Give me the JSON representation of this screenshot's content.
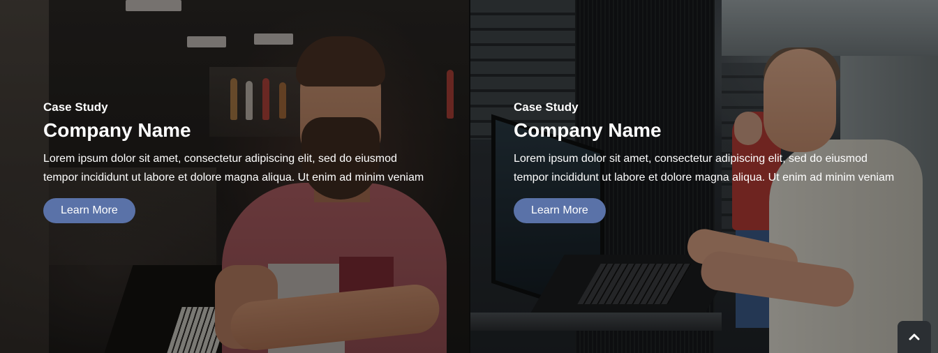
{
  "cards": [
    {
      "eyebrow": "Case Study",
      "title": "Company Name",
      "description": "Lorem ipsum dolor sit amet, consectetur adipiscing elit, sed do eiusmod tempor incididunt ut labore et dolore magna aliqua. Ut enim ad minim veniam",
      "button_label": "Learn More"
    },
    {
      "eyebrow": "Case Study",
      "title": "Company Name",
      "description": "Lorem ipsum dolor sit amet, consectetur adipiscing elit, sed do eiusmod tempor incididunt ut labore et dolore magna aliqua. Ut enim ad minim veniam",
      "button_label": "Learn More"
    }
  ],
  "scroll_top": {
    "icon": "chevron-up-icon"
  },
  "colors": {
    "button": "#5a72a8",
    "text": "#ffffff",
    "scroll_top_bg": "#2b2f33"
  }
}
